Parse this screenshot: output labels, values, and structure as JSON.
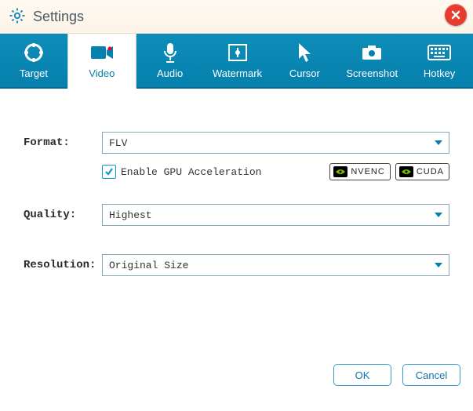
{
  "window": {
    "title": "Settings"
  },
  "tabs": {
    "target": "Target",
    "video": "Video",
    "audio": "Audio",
    "watermark": "Watermark",
    "cursor": "Cursor",
    "screenshot": "Screenshot",
    "hotkey": "Hotkey"
  },
  "form": {
    "format_label": "Format:",
    "format_value": "FLV",
    "gpu_label": "Enable GPU Acceleration",
    "gpu_checked": true,
    "badge_nvenc": "NVENC",
    "badge_cuda": "CUDA",
    "quality_label": "Quality:",
    "quality_value": "Highest",
    "resolution_label": "Resolution:",
    "resolution_value": "Original Size"
  },
  "buttons": {
    "ok": "OK",
    "cancel": "Cancel"
  }
}
